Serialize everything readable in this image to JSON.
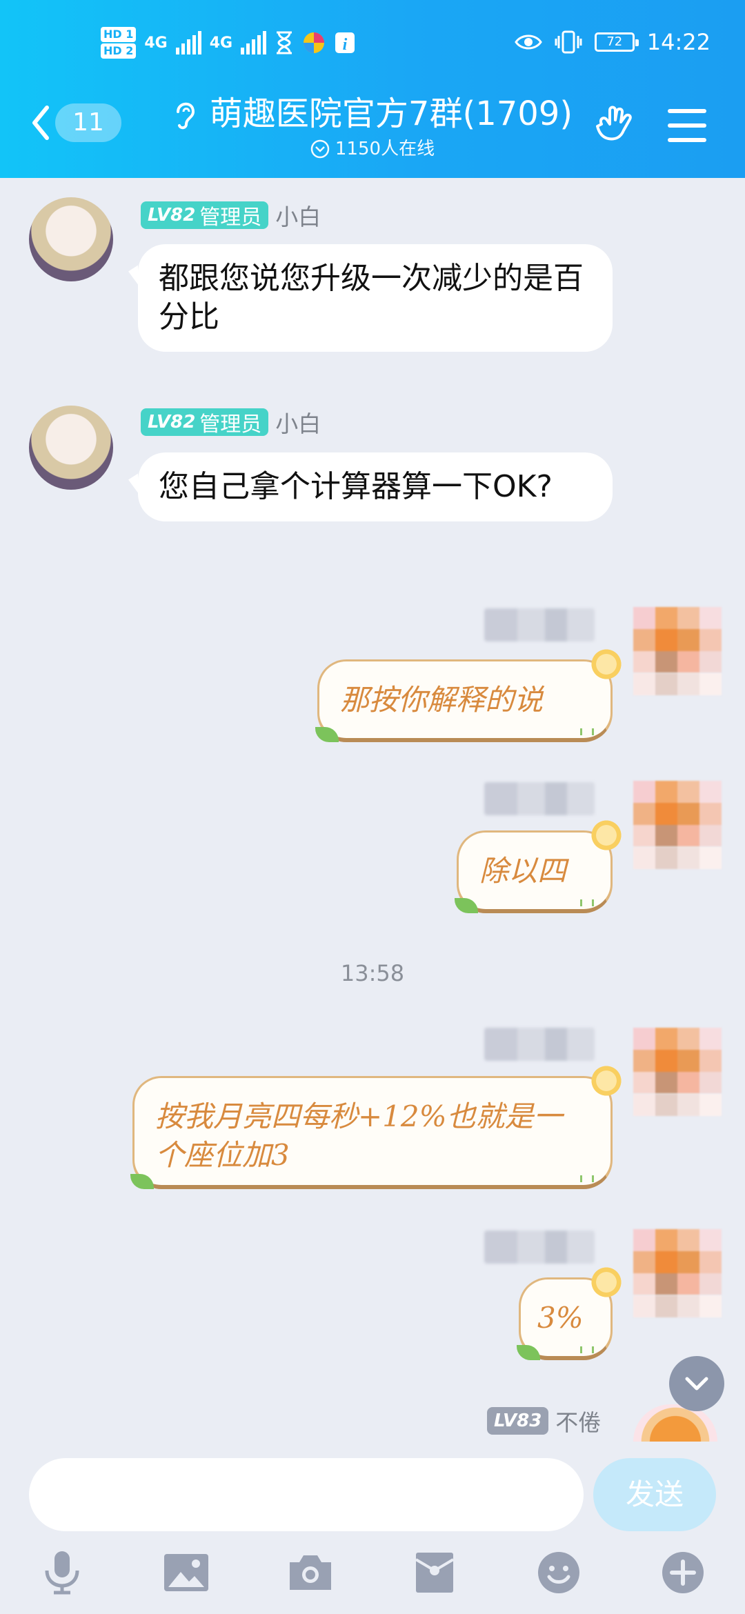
{
  "status_bar": {
    "hd1": "HD 1",
    "hd2": "HD 2",
    "net1": "4G",
    "net2": "4G",
    "battery": "72",
    "time": "14:22"
  },
  "header": {
    "unread_count": "11",
    "group_name": "萌趣医院官方7群(1709)",
    "online_count": "1150人在线"
  },
  "messages": [
    {
      "level": "LV82",
      "role": "管理员",
      "name": "小白",
      "text": "都跟您说您升级一次减少的是百分比"
    },
    {
      "level": "LV82",
      "role": "管理员",
      "name": "小白",
      "text": "您自己拿个计算器算一下OK?"
    },
    {
      "text": "那按你解释的说"
    },
    {
      "text": "除以四"
    },
    {
      "text": "按我月亮四每秒+12%也就是一个座位加3"
    },
    {
      "text": "3%"
    },
    {
      "level": "LV83",
      "name": "不倦"
    }
  ],
  "timestamp": "13:58",
  "input": {
    "placeholder": "",
    "send_label": "发送"
  },
  "colors": {
    "header_start": "#12c4f8",
    "header_end": "#1b9ef2",
    "admin_badge": "#46d3c8",
    "bubble_text": "#d88a3e",
    "chat_bg": "#eaedf4"
  },
  "toolbar_icons": [
    "mic-icon",
    "image-icon",
    "camera-icon",
    "red-packet-icon",
    "emoji-icon",
    "plus-icon"
  ]
}
